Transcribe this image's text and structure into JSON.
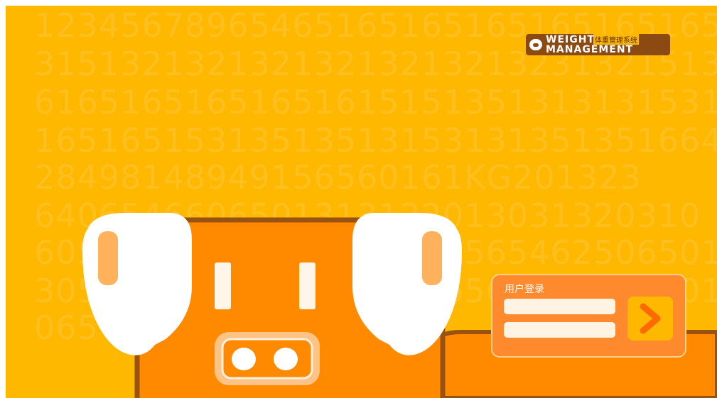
{
  "background": {
    "color": "#FFB800",
    "digit_rows": [
      "12345678965465165165165165165165",
      "31513213213213213213213231321513",
      "61651651651651615151351313131531351",
      "165165153135135131531313513516646418",
      "28498148949156560161KG201323",
      "6406546606501313122013031320310",
      "605654654651321565165654625065016505",
      "305654654651321565165654625065016505",
      "065"
    ]
  },
  "logo": {
    "word_top": "WEIGHT",
    "word_bottom": "MANAGEMENT",
    "cn_subtitle": "体重管理系统",
    "icon": "pig-icon",
    "plate_color": "#8A4A12"
  },
  "login": {
    "title": "用户登录",
    "username_value": "",
    "password_value": "",
    "submit_icon": "arrow-right-icon",
    "panel_color": "#FF8A2E",
    "button_color": "#FFB800",
    "arrow_color": "#FF6A00"
  },
  "illustration": {
    "body_color": "#FF8A00",
    "outline_color": "#9A5212",
    "ear_color": "#ffffff",
    "ear_inner_color": "#FFB15C"
  }
}
